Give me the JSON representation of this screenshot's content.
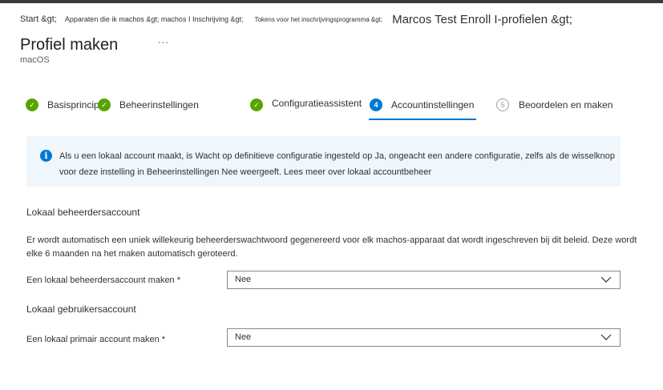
{
  "breadcrumb": {
    "items": [
      "Start &gt;",
      "Apparaten die ik machos &gt; machos I Inschrijving &gt;",
      "Tokens voor het inschrijvingsprogramma &gt;",
      "Marcos Test Enroll I-profielen &gt;"
    ]
  },
  "page": {
    "title": "Profiel maken",
    "more": "...",
    "subtitle": "macOS"
  },
  "steps": [
    {
      "number": "✓",
      "label": "Basisprincipes",
      "state": "done"
    },
    {
      "number": "✓",
      "label": "Beheerinstellingen",
      "state": "done"
    },
    {
      "number": "✓",
      "label": "Configuratieassistent",
      "state": "done"
    },
    {
      "number": "4",
      "label": "Accountinstellingen",
      "state": "active"
    },
    {
      "number": "5",
      "label": "Beoordelen en maken",
      "state": "pending"
    }
  ],
  "info": {
    "icon": "info-icon",
    "text": "Als u een lokaal account maakt, is Wacht op definitieve configuratie ingesteld op Ja, ongeacht een andere configuratie, zelfs als de wisselknop voor deze instelling in Beheerinstellingen Nee weergeeft. Lees meer over lokaal accountbeheer"
  },
  "admin_section": {
    "heading": "Lokaal beheerdersaccount",
    "description": "Er wordt automatisch een uniek willekeurig beheerderswachtwoord gegenereerd voor elk machos-apparaat dat wordt ingeschreven bij dit beleid. Deze wordt elke 6 maanden na het maken automatisch geroteerd.",
    "field_label": "Een lokaal beheerdersaccount maken *",
    "field_value": "Nee"
  },
  "user_section": {
    "heading": "Lokaal gebruikersaccount",
    "field_label": "Een lokaal primair account maken *",
    "field_value": "Nee"
  },
  "colors": {
    "accent": "#0078d4",
    "success": "#57a300",
    "info_background": "#eff6fc"
  }
}
